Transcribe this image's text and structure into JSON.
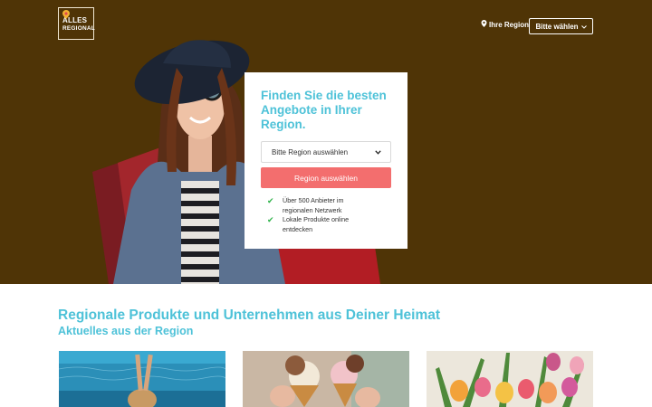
{
  "header": {
    "logo_lines": [
      "ALLES",
      "REGIONAL"
    ],
    "region_link": "Ihre Region",
    "choose_button": "Bitte wählen"
  },
  "hero_card": {
    "title": "Finden Sie die besten Angebote in Ihrer Region.",
    "select_value": "Bitte Region auswählen",
    "cta": "Region auswählen",
    "features": [
      "Über 500 Anbieter im regionalen Netzwerk",
      "Lokale Produkte online entdecken"
    ]
  },
  "section": {
    "title": "Regionale Produkte und Unternehmen aus Deiner Heimat",
    "subtitle": "Aktuelles aus der Region"
  },
  "colors": {
    "hero_bg": "#4f3406",
    "accent_teal": "#4ec2d8",
    "cta_red": "#f36e6e",
    "check_green": "#2fb34a"
  }
}
